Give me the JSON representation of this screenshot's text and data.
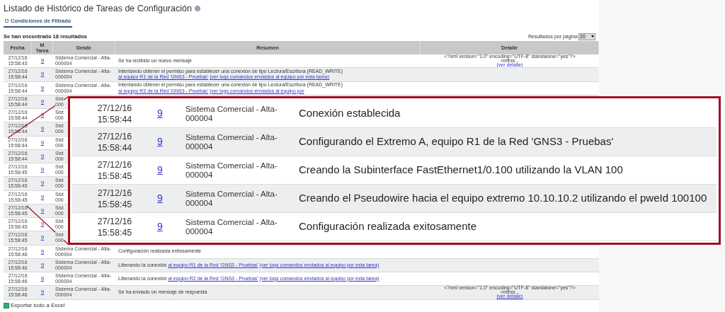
{
  "title": "Listado de Histórico de Tareas de Configuración",
  "filter_tab": {
    "label": "Condiciones de Filtrado",
    "selected": true
  },
  "results_count": "Se han encontrado 18 resultados",
  "per_page": {
    "label": "Resultados por página",
    "value": "20"
  },
  "table": {
    "columns": [
      "Fecha",
      "Id Tarea",
      "Desde",
      "Resumen",
      "Detalle"
    ],
    "rows": [
      {
        "date": "27/12/16",
        "time": "15:58:43",
        "id": "9",
        "from": [
          "Sistema Comercial - Alta-",
          "000004"
        ],
        "summary": "Se ha recibido un nuevo mensaje",
        "detail": [
          "<?xml version=\"1.0\" encoding=\"UTF-8\" standalone=\"yes\"?>",
          "<mess..."
        ],
        "detail_link": "(ver detalle)"
      },
      {
        "date": "27/12/16",
        "time": "15:58:44",
        "id": "9",
        "from": [
          "Sistema Comercial - Alta-",
          "000004"
        ],
        "summary": "Intentando obtener el permiso para establecer una conexión de tipo Lectura/Escritura (READ_WRITE)",
        "link": "al equipo R1 de la Red 'GNS3 - Pruebas'",
        "log_link": "(ver logs comandos enviados al equipo por esta tarea)"
      },
      {
        "date": "27/12/16",
        "time": "15:58:44",
        "id": "9",
        "from": [
          "Sistema Comercial - Alta-",
          "000004"
        ],
        "summary": "Intentando obtener el permiso para establecer una conexión de tipo Lectura/Escritura (READ_WRITE)",
        "link": "al equipo R2 de la Red 'GNS3 - Pruebas'",
        "log_link": "(ver logs comandos enviados al equipo por"
      },
      {
        "date": "27/12/16",
        "time": "15:58:44",
        "id": "9",
        "from": [
          "Sist",
          "000"
        ]
      },
      {
        "date": "27/12/16",
        "time": "15:58:44",
        "id": "9",
        "from": [
          "Sist",
          "000"
        ]
      },
      {
        "date": "27/12/16",
        "time": "15:58:44",
        "id": "9",
        "from": [
          "Sist",
          "000"
        ]
      },
      {
        "date": "27/12/16",
        "time": "15:58:44",
        "id": "9",
        "from": [
          "Sist",
          "000"
        ]
      },
      {
        "date": "27/12/16",
        "time": "15:58:44",
        "id": "9",
        "from": [
          "Sist",
          "000"
        ]
      },
      {
        "date": "27/12/16",
        "time": "15:58:45",
        "id": "9",
        "from": [
          "Sist",
          "000"
        ]
      },
      {
        "date": "27/12/16",
        "time": "15:58:45",
        "id": "9",
        "from": [
          "Sist",
          "000"
        ]
      },
      {
        "date": "27/12/16",
        "time": "15:58:45",
        "id": "9",
        "from": [
          "Sist",
          "000"
        ]
      },
      {
        "date": "27/12/16",
        "time": "15:58:45",
        "id": "9",
        "from": [
          "Sist",
          "000"
        ]
      },
      {
        "date": "27/12/16",
        "time": "15:58:45",
        "id": "9",
        "from": [
          "Sist",
          "000"
        ]
      },
      {
        "date": "27/12/16",
        "time": "15:58:45",
        "id": "9",
        "from": [
          "Sist",
          "000"
        ]
      },
      {
        "date": "27/12/16",
        "time": "15:58:46",
        "id": "9",
        "from": [
          "Sistema Comercial - Alta-",
          "000004"
        ],
        "summary": "Configuración realizada exitosamente"
      },
      {
        "date": "27/12/16",
        "time": "15:58:46",
        "id": "9",
        "from": [
          "Sistema Comercial - Alta-",
          "000004"
        ],
        "summary": "Liberando la conexión",
        "link": "al equipo R1 de la Red 'GNS3 - Pruebas'",
        "log_link": "(ver logs comandos enviados al equipo por esta tarea)"
      },
      {
        "date": "27/12/16",
        "time": "15:58:46",
        "id": "9",
        "from": [
          "Sistema Comercial - Alta-",
          "000004"
        ],
        "summary": "Liberando la conexión",
        "link": "al equipo R2 de la Red 'GNS3 - Pruebas'",
        "log_link": "(ver logs comandos enviados al equipo por esta tarea)"
      },
      {
        "date": "27/12/16",
        "time": "15:58:46",
        "id": "9",
        "from": [
          "Sistema Comercial - Alta-",
          "000004"
        ],
        "summary": "Se ha enviado un mensaje de respuesta",
        "detail": [
          "<?xml version=\"1.0\" encoding=\"UTF-8\" standalone=\"yes\"?>",
          "<mess..."
        ],
        "detail_link": "(ver detalle)"
      }
    ]
  },
  "zoom_inset": {
    "rows": [
      {
        "date": "27/12/16",
        "time": "15:58:44",
        "id": "9",
        "from": [
          "Sistema Comercial - Alta-",
          "000004"
        ],
        "summary": "Conexión establecida"
      },
      {
        "date": "27/12/16",
        "time": "15:58:44",
        "id": "9",
        "from": [
          "Sistema Comercial - Alta-",
          "000004"
        ],
        "summary": "Configurando el Extremo A, equipo R1 de la Red 'GNS3 - Pruebas'"
      },
      {
        "date": "27/12/16",
        "time": "15:58:45",
        "id": "9",
        "from": [
          "Sistema Comercial - Alta-",
          "000004"
        ],
        "summary": "Creando la Subinterface FastEthernet1/0.100 utilizando la VLAN 100"
      },
      {
        "date": "27/12/16",
        "time": "15:58:45",
        "id": "9",
        "from": [
          "Sistema Comercial - Alta-",
          "000004"
        ],
        "summary": "Creando el Pseudowire hacia el equipo extremo 10.10.10.2 utilizando el pweId 100100"
      },
      {
        "date": "27/12/16",
        "time": "15:58:45",
        "id": "9",
        "from": [
          "Sistema Comercial - Alta-",
          "000004"
        ],
        "summary": "Configuración realizada exitosamente"
      }
    ]
  },
  "export_link": "Exportar todo a Excel"
}
